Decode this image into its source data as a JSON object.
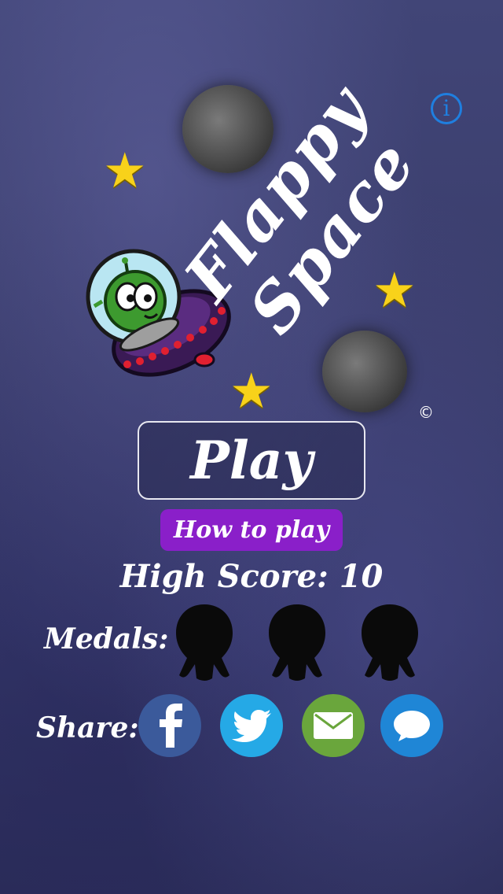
{
  "title": {
    "line1": "Flappy",
    "line2": "Space"
  },
  "copyright": "©",
  "buttons": {
    "info_label": "i",
    "play_label": "Play",
    "how_to_play_label": "How to play"
  },
  "high_score": {
    "label": "High Score:",
    "value": "10",
    "text": "High Score: 10"
  },
  "medals": {
    "label": "Medals:",
    "count": 3,
    "state": "locked"
  },
  "share": {
    "label": "Share:",
    "services": [
      {
        "name": "facebook",
        "icon": "facebook-icon",
        "color": "#3b5a9b"
      },
      {
        "name": "twitter",
        "icon": "twitter-bird-icon",
        "color": "#25a9e6"
      },
      {
        "name": "email",
        "icon": "envelope-icon",
        "color": "#6aa63c"
      },
      {
        "name": "message",
        "icon": "speech-bubble-icon",
        "color": "#1f86d6"
      }
    ]
  },
  "colors": {
    "accent_purple": "#8a1fc9",
    "info_blue": "#1f7fe0",
    "star_yellow": "#f8d21a"
  }
}
